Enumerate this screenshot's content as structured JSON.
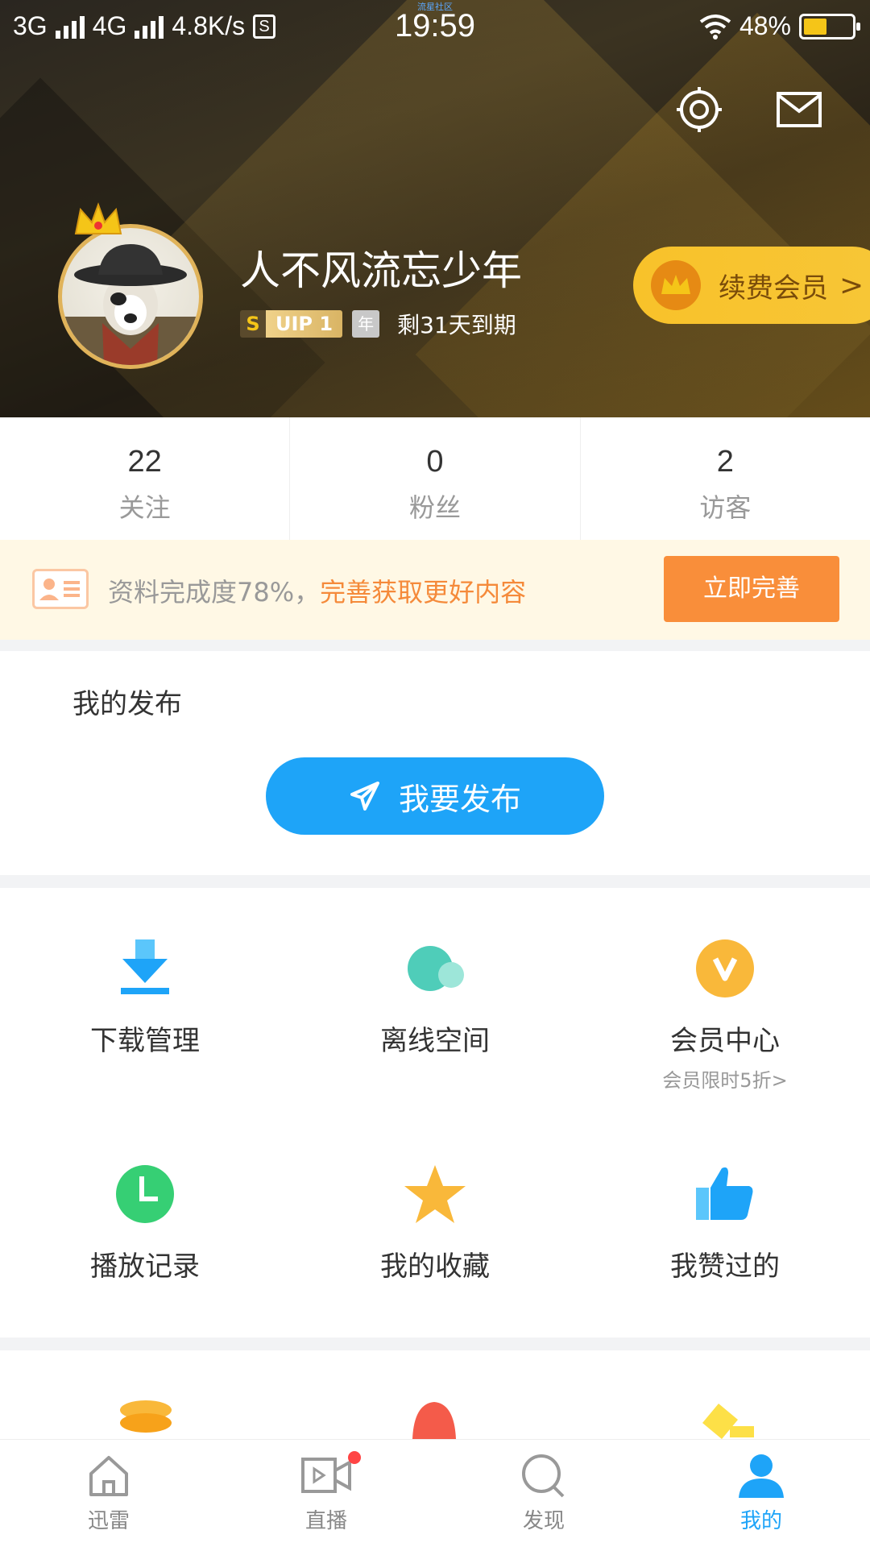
{
  "status_bar": {
    "network_1": "3G",
    "network_2": "4G",
    "speed": "4.8K/s",
    "s_icon_label": "S",
    "time": "19:59",
    "micro_label": "流星社区",
    "battery": "48%",
    "battery_level": 0.48
  },
  "header": {
    "username": "人不风流忘少年",
    "vip_s": "S",
    "vip_label": "UIP 1",
    "year_badge": "年",
    "expire_text": "剩31天到期",
    "renew_label": "续费会员",
    "renew_chevron": ">"
  },
  "stats": [
    {
      "num": "22",
      "label": "关注"
    },
    {
      "num": "0",
      "label": "粉丝"
    },
    {
      "num": "2",
      "label": "访客"
    }
  ],
  "profile_completion": {
    "text": "资料完成度78%，",
    "highlight": "完善获取更好内容",
    "button": "立即完善"
  },
  "publish": {
    "title": "我的发布",
    "button": "我要发布"
  },
  "grid": [
    {
      "label": "下载管理",
      "icon": "download-icon",
      "color": "#1ea4f8"
    },
    {
      "label": "离线空间",
      "icon": "cloud-icon",
      "color": "#4fcdb9"
    },
    {
      "label": "会员中心",
      "sub": "会员限时5折>",
      "icon": "vip-icon",
      "color": "#f9b83a"
    },
    {
      "label": "播放记录",
      "icon": "clock-icon",
      "color": "#36cf74"
    },
    {
      "label": "我的收藏",
      "icon": "star-icon",
      "color": "#f9b83a"
    },
    {
      "label": "我赞过的",
      "icon": "thumbs-up-icon",
      "color": "#1ea4f8"
    }
  ],
  "tabs": [
    {
      "label": "迅雷",
      "icon": "home-icon"
    },
    {
      "label": "直播",
      "icon": "live-video-icon"
    },
    {
      "label": "发现",
      "icon": "search-icon"
    },
    {
      "label": "我的",
      "icon": "user-icon",
      "active": true
    }
  ],
  "colors": {
    "accent": "#1ea4f8",
    "renew_bg": "#f8c22a",
    "complete_button": "#f98e3a"
  }
}
